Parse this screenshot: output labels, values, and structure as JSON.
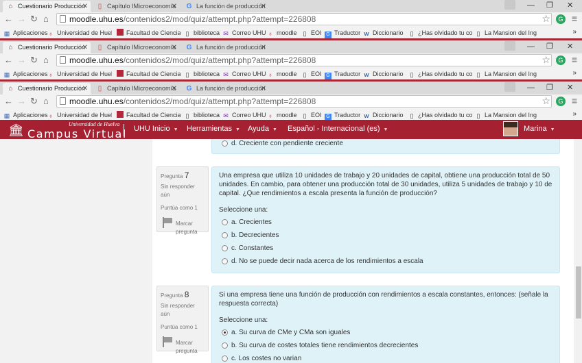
{
  "browser": {
    "tabs": [
      {
        "title": "Cuestionario Producción"
      },
      {
        "title": "Capítulo IMicroeconomía"
      },
      {
        "title": "La función de producción"
      }
    ],
    "url_host": "moodle.uhu.es",
    "url_path": "/contenidos2/mod/quiz/attempt.php?attempt=226808",
    "bookmarks": [
      "Aplicaciones",
      "Universidad de Huelv",
      "Facultad de Ciencias E",
      "biblioteca",
      "Correo UHU",
      "moodle",
      "EOI",
      "Traductor",
      "Diccionario",
      "¿Has olvidado tu cont",
      "La Mansion del Ingles"
    ],
    "more": "»",
    "ext_label": "G"
  },
  "moodle": {
    "logo_top": "Universidad de Huelva",
    "logo_main": "Campus Virtual",
    "nav": [
      "UHU Inicio",
      "Herramientas",
      "Ayuda",
      "Español - Internacional (es)"
    ],
    "user": "Marina"
  },
  "previous_option": "d. Creciente con pendiente creciente",
  "questions": [
    {
      "label": "Pregunta",
      "number": "7",
      "status": "Sin responder aún",
      "score": "Puntúa como 1",
      "flag_label": "Marcar pregunta",
      "text": "Una empresa que utiliza 10 unidades de trabajo y 20 unidades de capital, obtiene una producción total de 50 unidades. En cambio, para obtener una producción total de 30 unidades, utiliza 5 unidades de trabajo y 10 de capital.  ¿Que rendimientos a escala presenta la función de producción?",
      "select_label": "Seleccione una:",
      "options": [
        "a. Crecientes",
        "b. Decrecientes",
        "c. Constantes",
        "d. No se puede decir nada acerca de los rendimientos a escala"
      ],
      "selected": -1
    },
    {
      "label": "Pregunta",
      "number": "8",
      "status": "Sin responder aún",
      "score": "Puntúa como 1",
      "flag_label": "Marcar pregunta",
      "text": "Si una empresa tiene una función de producción con rendimientos a escala constantes, entonces: (señale la respuesta correcta)",
      "select_label": "Seleccione una:",
      "options": [
        "a. Su curva de CMe y CMa son iguales",
        "b. Su curva de costes totales tiene rendimientos decrecientes",
        "c. Los costes no varian"
      ],
      "selected": 0
    }
  ],
  "colors": {
    "brand": "#a52131",
    "question_bg": "#def2f8"
  }
}
